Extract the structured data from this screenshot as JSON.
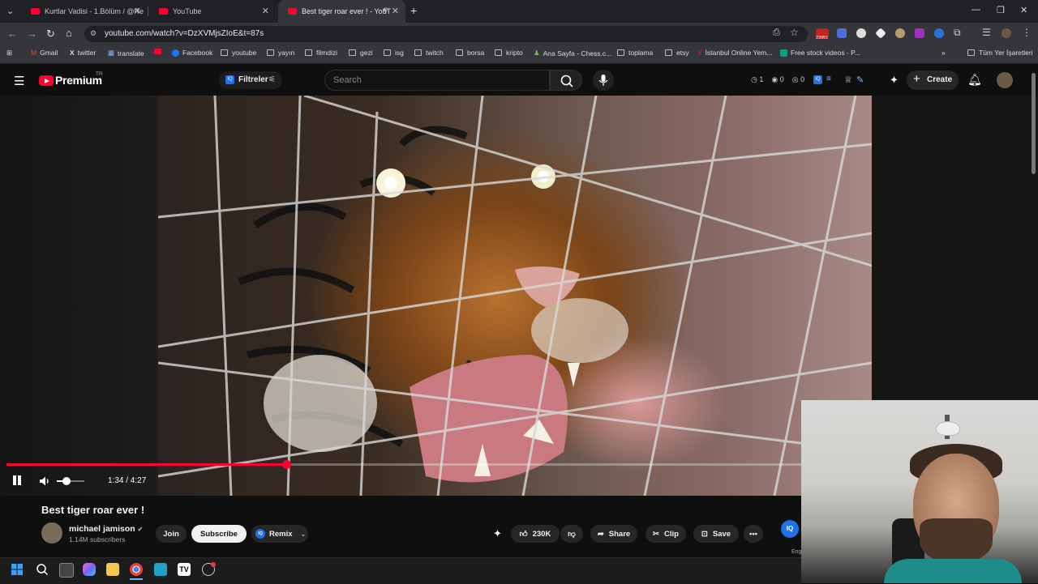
{
  "browser": {
    "tabs": [
      {
        "title": "Kurtlar Vadisi - 1.Bölüm / @Re",
        "active": false
      },
      {
        "title": "YouTube",
        "active": false
      },
      {
        "title": "Best tiger roar ever ! - YouT",
        "active": true
      }
    ],
    "new_tab_symbol": "+",
    "url": "youtube.com/watch?v=DzXVMjsZIoE&t=87s",
    "extension_badge": "23951",
    "bookmarks": [
      "Gmail",
      "twitter",
      "translate",
      "",
      "Facebook",
      "youtube",
      "yayın",
      "filmdizi",
      "gezi",
      "isg",
      "twitch",
      "borsa",
      "kripto",
      "Ana Sayfa - Chess.c...",
      "toplama",
      "etsy",
      "İstanbul Online Yem...",
      "Free stock videos - P..."
    ],
    "all_bookmarks_label": "Tüm Yer İşaretleri"
  },
  "youtube": {
    "logo_text": "Premium",
    "region": "TR",
    "filters_label": "Filtreler",
    "search_placeholder": "Search",
    "counters": [
      "1",
      "0",
      "0"
    ],
    "create_label": "Create"
  },
  "player": {
    "current_time": "1:34",
    "duration": "4:27",
    "time_display": "1:34 / 4:27",
    "progress_fraction": 0.352,
    "volume_fraction": 0.35,
    "accent_color": "#ff0033"
  },
  "video": {
    "title": "Best tiger roar ever !",
    "channel_name": "michael jamison",
    "subscribers": "1.14M subscribers",
    "join_label": "Join",
    "subscribe_label": "Subscribe",
    "remix_label": "Remix",
    "likes": "230K",
    "share_label": "Share",
    "clip_label": "Clip",
    "save_label": "Save",
    "side_partial": "Eng"
  }
}
